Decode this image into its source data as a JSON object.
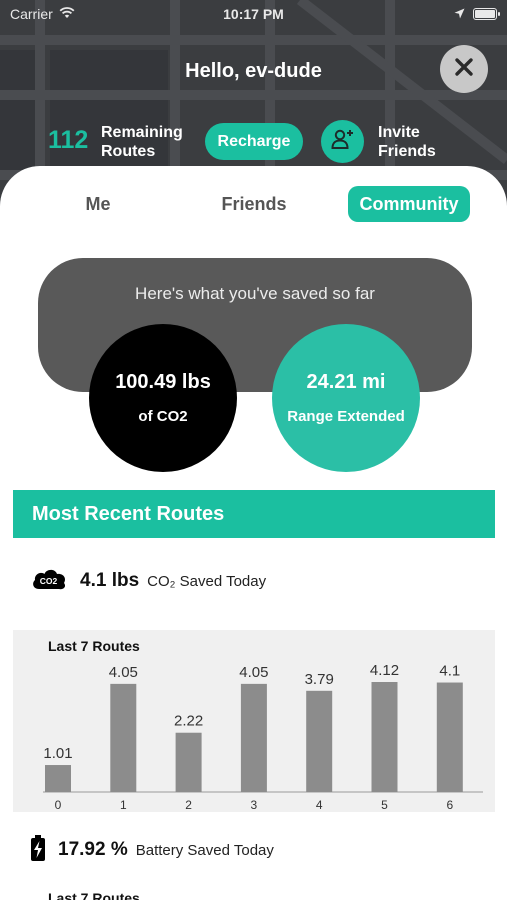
{
  "status_bar": {
    "carrier": "Carrier",
    "time": "10:17 PM"
  },
  "header": {
    "greeting": "Hello, ev-dude",
    "remaining_routes_count": "112",
    "remaining_routes_label_line1": "Remaining",
    "remaining_routes_label_line2": "Routes",
    "recharge_label": "Recharge",
    "invite_label_line1": "Invite",
    "invite_label_line2": "Friends"
  },
  "tabs": [
    {
      "label": "Me",
      "active": false
    },
    {
      "label": "Friends",
      "active": false
    },
    {
      "label": "Community",
      "active": true
    }
  ],
  "saved": {
    "title": "Here's what you've saved so far",
    "co2_value": "100.49 lbs",
    "co2_label": "of CO2",
    "range_value": "24.21 mi",
    "range_label": "Range Extended"
  },
  "recent": {
    "section_title": "Most Recent Routes",
    "co2_badge": "CO2",
    "co2_today_value": "4.1 lbs",
    "co2_today_label": "CO₂ Saved Today",
    "battery_today_value": "17.92 %",
    "battery_today_label": "Battery Saved Today",
    "second_chart_title": "Last 7 Routes"
  },
  "chart_data": {
    "type": "bar",
    "title": "Last 7 Routes",
    "categories": [
      "0",
      "1",
      "2",
      "3",
      "4",
      "5",
      "6"
    ],
    "values": [
      1.01,
      4.05,
      2.22,
      4.05,
      3.79,
      4.12,
      4.1
    ],
    "value_labels": [
      "1.01",
      "4.05",
      "2.22",
      "4.05",
      "3.79",
      "4.12",
      "4.1"
    ],
    "ylim": [
      0,
      4.12
    ],
    "bar_color": "#8c8c8c",
    "grid": false
  },
  "colors": {
    "accent": "#1bbfa0",
    "dark_header": "#3b3d40",
    "card_gray": "#595959"
  },
  "icons": {
    "wifi": "wifi-icon",
    "location": "location-arrow-icon",
    "battery": "battery-icon",
    "close": "close-icon",
    "invite": "add-person-icon",
    "co2": "co2-cloud-icon",
    "battery_saved": "battery-charging-icon"
  }
}
